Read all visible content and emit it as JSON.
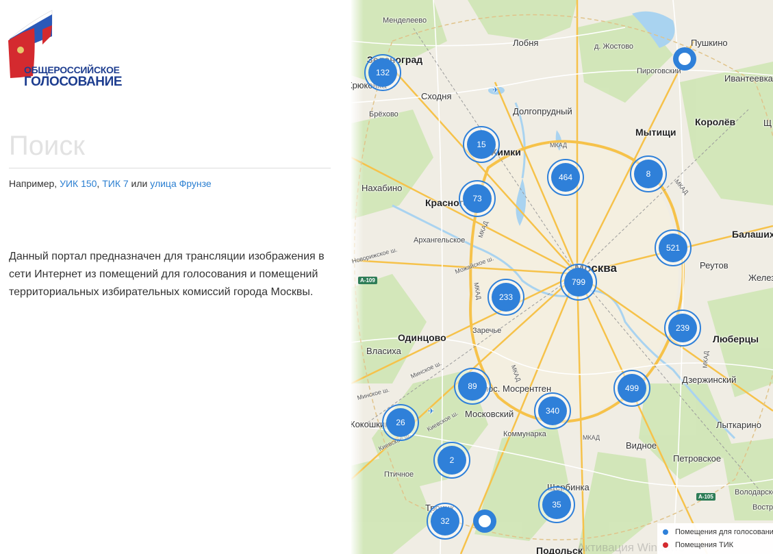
{
  "logo": {
    "line1": "ОБЩЕРОССИЙСКОЕ",
    "line2": "ГОЛОСОВАНИЕ",
    "colors": {
      "white": "#ffffff",
      "blue": "#1f50b4",
      "red": "#d42a2f",
      "text": "#1d3d8f"
    }
  },
  "search": {
    "placeholder": "Поиск",
    "value": ""
  },
  "hint": {
    "prefix": "Например, ",
    "link1": "УИК 150",
    "sep1": ", ",
    "link2": "ТИК 7",
    "sep2": " или ",
    "link3": "улица Фрунзе"
  },
  "description": "Данный портал предназначен для трансляции изображения в сети Интернет из помещений для голосования и помещений территориальных избирательных комиссий города Москвы.",
  "map": {
    "places": [
      {
        "name": "Менделеево",
        "size": "small"
      },
      {
        "name": "Лобня",
        "size": "mid"
      },
      {
        "name": "д. Жостово",
        "size": "small"
      },
      {
        "name": "Пушкино",
        "size": "mid"
      },
      {
        "name": "Зеленоград",
        "size": "big"
      },
      {
        "name": "Пироговский",
        "size": "small"
      },
      {
        "name": "Ивантеевка",
        "size": "mid"
      },
      {
        "name": "Крюковка",
        "size": "mid"
      },
      {
        "name": "Сходня",
        "size": "mid"
      },
      {
        "name": "Долгопрудный",
        "size": "mid"
      },
      {
        "name": "Брёхово",
        "size": "small"
      },
      {
        "name": "Мытищи",
        "size": "big"
      },
      {
        "name": "Королёв",
        "size": "big"
      },
      {
        "name": "Щ",
        "size": "mid"
      },
      {
        "name": "Химки",
        "size": "big"
      },
      {
        "name": "Нахабино",
        "size": "mid"
      },
      {
        "name": "Красногорск",
        "size": "big"
      },
      {
        "name": "Балашиха",
        "size": "big"
      },
      {
        "name": "Архангельское",
        "size": "small"
      },
      {
        "name": "Реутов",
        "size": "mid"
      },
      {
        "name": "Москва",
        "size": "city"
      },
      {
        "name": "Железнодорожный",
        "size": "mid"
      },
      {
        "name": "Заречье",
        "size": "small"
      },
      {
        "name": "Одинцово",
        "size": "big"
      },
      {
        "name": "Люберцы",
        "size": "big"
      },
      {
        "name": "Власиха",
        "size": "mid"
      },
      {
        "name": "Дзержинский",
        "size": "mid"
      },
      {
        "name": "пос. Мосрентген",
        "size": "mid"
      },
      {
        "name": "Московский",
        "size": "mid"
      },
      {
        "name": "Кокошкино",
        "size": "mid"
      },
      {
        "name": "Коммунарка",
        "size": "small"
      },
      {
        "name": "Лыткарино",
        "size": "mid"
      },
      {
        "name": "Видное",
        "size": "mid"
      },
      {
        "name": "Петровское",
        "size": "mid"
      },
      {
        "name": "Птичное",
        "size": "small"
      },
      {
        "name": "Щербинка",
        "size": "mid"
      },
      {
        "name": "Володарское",
        "size": "small"
      },
      {
        "name": "Троицк",
        "size": "mid"
      },
      {
        "name": "Вострякове",
        "size": "small"
      },
      {
        "name": "Подольск",
        "size": "big"
      }
    ],
    "road_labels": [
      "МКАД",
      "МКАД",
      "МКАД",
      "МКАД",
      "МКАД",
      "МКАД",
      "МКАД",
      "Можайское ш.",
      "Минское ш.",
      "Минское ш.",
      "Киевское ш.",
      "Киевское ш.",
      "Новорижское ш."
    ],
    "shields": [
      "А-109",
      "А-105"
    ],
    "clusters": [
      {
        "count": "132"
      },
      {
        "count": "15"
      },
      {
        "count": "464"
      },
      {
        "count": "8"
      },
      {
        "count": "73"
      },
      {
        "count": "521"
      },
      {
        "count": "799"
      },
      {
        "count": "233"
      },
      {
        "count": "239"
      },
      {
        "count": "89"
      },
      {
        "count": "499"
      },
      {
        "count": "340"
      },
      {
        "count": "26"
      },
      {
        "count": "2"
      },
      {
        "count": "35"
      },
      {
        "count": "32"
      }
    ],
    "cluster_color": "#2f80d9",
    "legend": [
      {
        "label": "Помещения для голосования",
        "color": "#2f80d9"
      },
      {
        "label": "Помещения ТИК",
        "color": "#d42a2f"
      }
    ],
    "watermark": "Активация Windows"
  }
}
